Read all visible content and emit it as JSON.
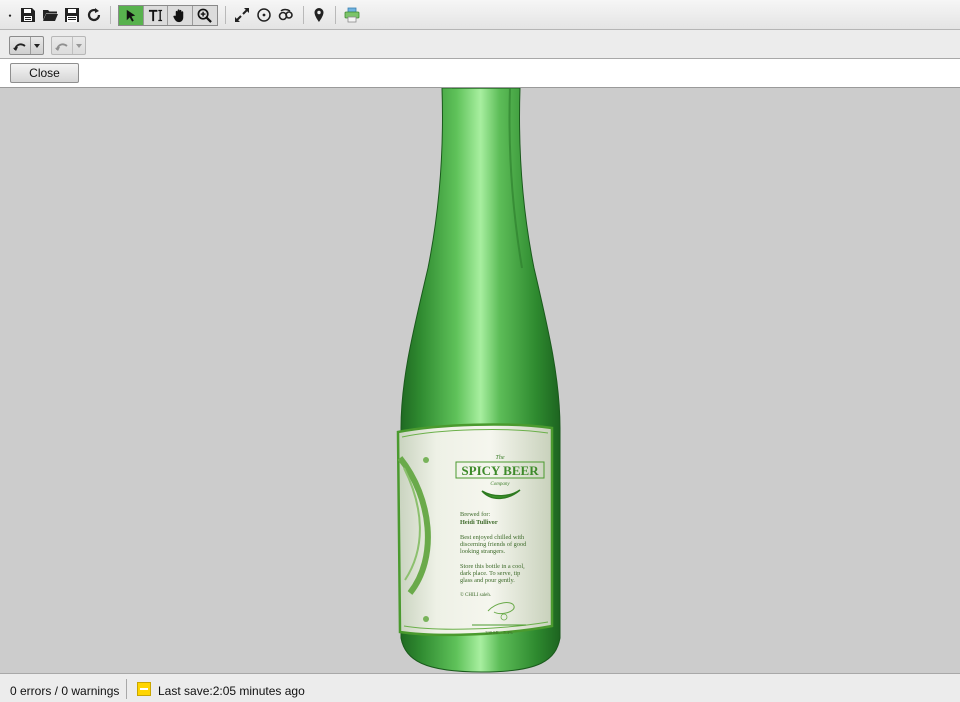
{
  "toolbar": {
    "icons": [
      "new-dot-icon",
      "save-icon",
      "open-folder-icon",
      "save-as-icon",
      "refresh-icon",
      "select-arrow-icon",
      "text-tool-icon",
      "hand-pan-icon",
      "zoom-icon",
      "expand-icon",
      "target-icon",
      "render-icon",
      "pin-icon",
      "print-icon"
    ],
    "active_tool": "select-arrow-icon"
  },
  "toolbar2": {
    "undo": "undo-icon",
    "redo": "redo-icon"
  },
  "closebar": {
    "close_label": "Close"
  },
  "label": {
    "the": "The",
    "brand": "SPICY BEER",
    "company": "Company",
    "brewed_for": "Brewed for:",
    "recipient": "Heidi Tullivor",
    "line1": "Best enjoyed chilled with",
    "line2": "discerning friends of good",
    "line3": "looking strangers.",
    "line4": "Store this bottle in a cool,",
    "line5": "dark place. To serve, tip",
    "line6": "glass and pour gently.",
    "copyright": "© CHILI saleh.",
    "footer": "330 ML · 5.4%"
  },
  "status": {
    "errors": "0 errors / 0 warnings",
    "last_save": "Last save:2:05 minutes ago"
  },
  "colors": {
    "active_tool": "#58b24e",
    "viewport_bg": "#cccccc",
    "bottle_green": "#3f9a3c",
    "label_green": "#4a9a2e",
    "save_indicator": "#ffd500"
  }
}
